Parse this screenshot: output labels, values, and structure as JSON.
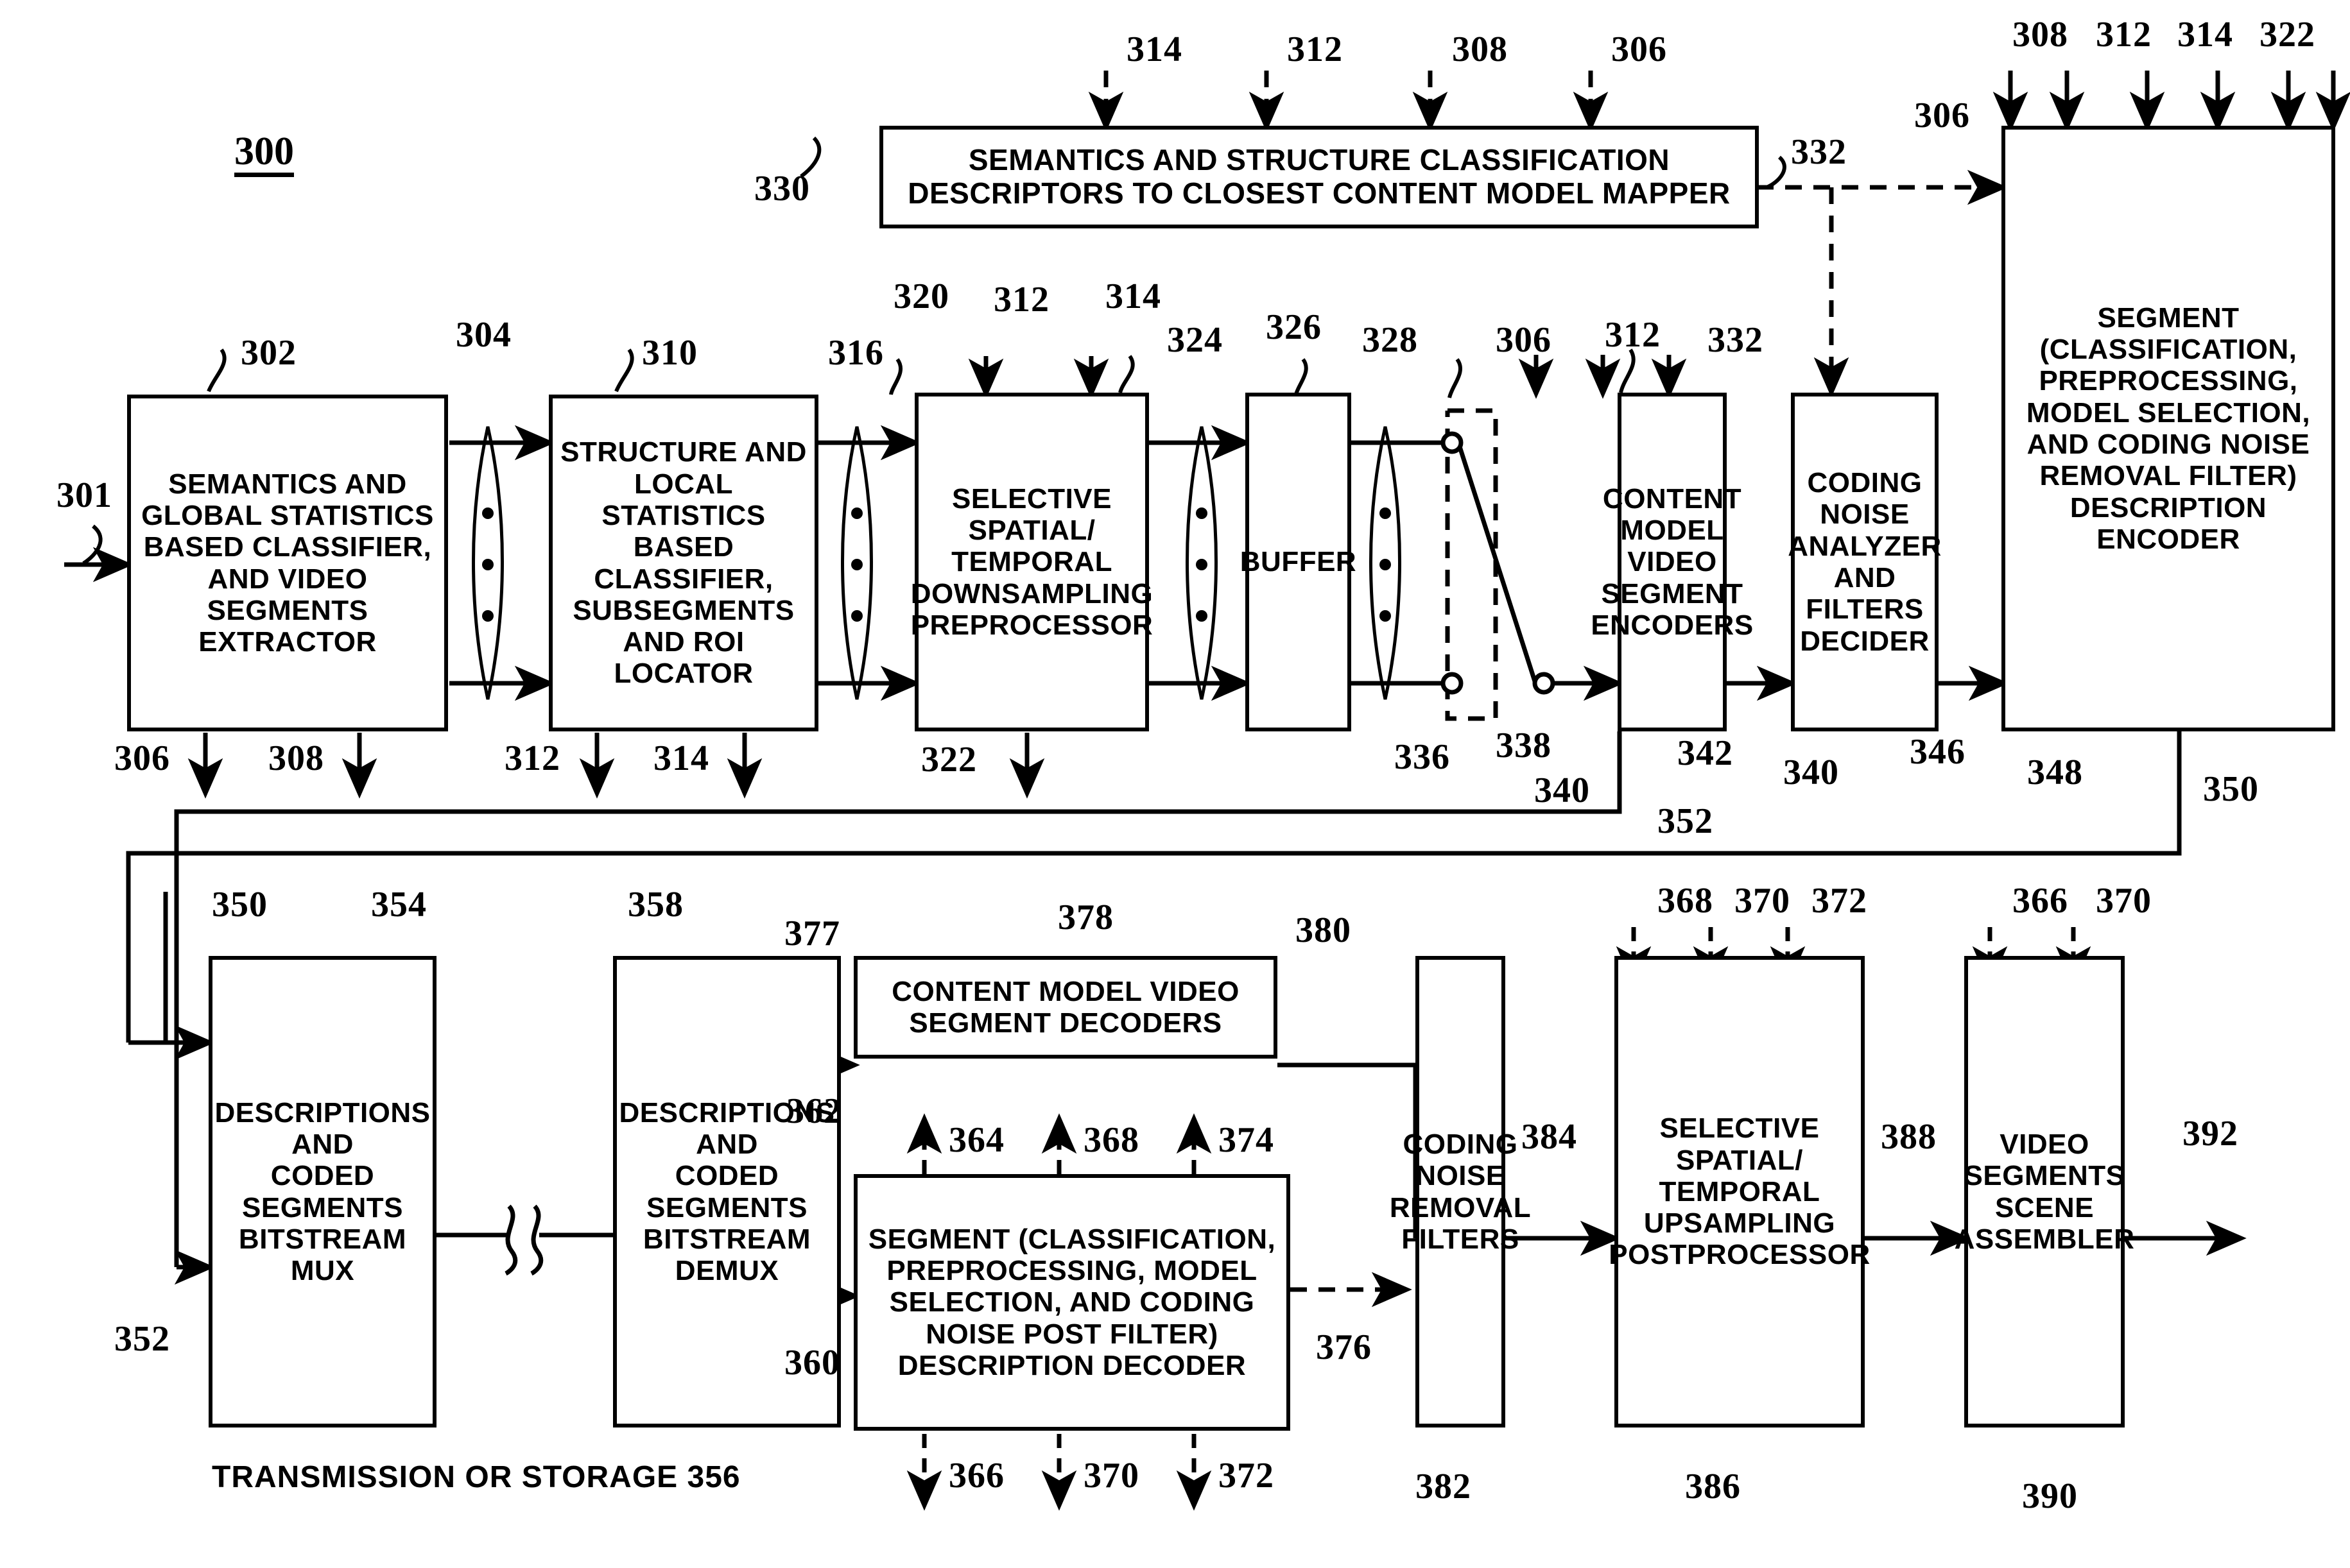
{
  "figure": {
    "number": "300"
  },
  "blocks": [
    {
      "id": "302",
      "label": "SEMANTICS AND\nGLOBAL STATISTICS\nBASED CLASSIFIER,\nAND VIDEO\nSEGMENTS\nEXTRACTOR"
    },
    {
      "id": "310",
      "label": "STRUCTURE AND\nLOCAL STATISTICS\nBASED\nCLASSIFIER,\nSUBSEGMENTS\nAND ROI LOCATOR"
    },
    {
      "id": "320",
      "label": "SELECTIVE\nSPATIAL/\nTEMPORAL\nDOWNSAMPLING\nPREPROCESSOR"
    },
    {
      "id": "326",
      "label": "BUFFER"
    },
    {
      "id": "330",
      "label": "SEMANTICS AND STRUCTURE CLASSIFICATION\nDESCRIPTORS TO CLOSEST CONTENT MODEL MAPPER"
    },
    {
      "id": "340",
      "label": "CONTENT\nMODEL\nVIDEO\nSEGMENT\nENCODERS"
    },
    {
      "id": "346",
      "label": "CODING\nNOISE\nANALYZER\nAND\nFILTERS\nDECIDER"
    },
    {
      "id": "348",
      "label": "SEGMENT\n(CLASSIFICATION,\nPREPROCESSING,\nMODEL SELECTION,\nAND CODING NOISE\nREMOVAL FILTER)\nDESCRIPTION\nENCODER"
    },
    {
      "id": "354",
      "label": "DESCRIPTIONS\nAND\nCODED\nSEGMENTS\nBITSTREAM\nMUX"
    },
    {
      "id": "358",
      "label": "DESCRIPTIONS\nAND\nCODED\nSEGMENTS\nBITSTREAM\nDEMUX"
    },
    {
      "id": "378",
      "label": "CONTENT MODEL VIDEO\nSEGMENT DECODERS"
    },
    {
      "id": "360",
      "label": "SEGMENT (CLASSIFICATION,\nPREPROCESSING, MODEL\nSELECTION, AND CODING\nNOISE POST FILTER)\nDESCRIPTION DECODER"
    },
    {
      "id": "382",
      "label": "CODING\nNOISE\nREMOVAL\nFILTERS"
    },
    {
      "id": "386",
      "label": "SELECTIVE\nSPATIAL/\nTEMPORAL\nUPSAMPLING\nPOSTPROCESSOR"
    },
    {
      "id": "390",
      "label": "VIDEO\nSEGMENTS\nSCENE\nASSEMBLER"
    }
  ],
  "caption": {
    "transmission": "TRANSMISSION OR STORAGE 356"
  },
  "refs": {
    "fig": "300",
    "r301": "301",
    "r302": "302",
    "r304": "304",
    "r306": "306",
    "r308": "308",
    "r310": "310",
    "r312": "312",
    "r314": "314",
    "r316": "316",
    "r320": "320",
    "r322": "322",
    "r324": "324",
    "r326": "326",
    "r328": "328",
    "r330": "330",
    "r332": "332",
    "r336": "336",
    "r338": "338",
    "r340": "340",
    "r342": "342",
    "r346": "346",
    "r348": "348",
    "r350": "350",
    "r352": "352",
    "r354": "354",
    "r358": "358",
    "r360": "360",
    "r362": "362",
    "r364": "364",
    "r366": "366",
    "r368": "368",
    "r370": "370",
    "r372": "372",
    "r374": "374",
    "r376": "376",
    "r377": "377",
    "r378": "378",
    "r380": "380",
    "r382": "382",
    "r384": "384",
    "r386": "386",
    "r388": "388",
    "r390": "390",
    "r392": "392"
  },
  "ref_top_mapper": [
    "314",
    "312",
    "308",
    "306"
  ],
  "ref_top_encoder": [
    "306",
    "308",
    "312",
    "314",
    "322"
  ],
  "ref_bottom_row1": [
    "306",
    "308",
    "312",
    "314",
    "322"
  ],
  "ref_top_preproc": [
    "312",
    "314"
  ],
  "ref_top_cmvse": [
    "306",
    "312",
    "332"
  ],
  "ref_decoder_up": [
    "364",
    "368",
    "374"
  ],
  "ref_decoder_down": [
    "366",
    "370",
    "372"
  ],
  "ref_top_upsampler": [
    "368",
    "370",
    "372"
  ],
  "ref_top_assembler": [
    "366",
    "370"
  ],
  "colors": {
    "ink": "#000000",
    "paper": "#ffffff"
  }
}
